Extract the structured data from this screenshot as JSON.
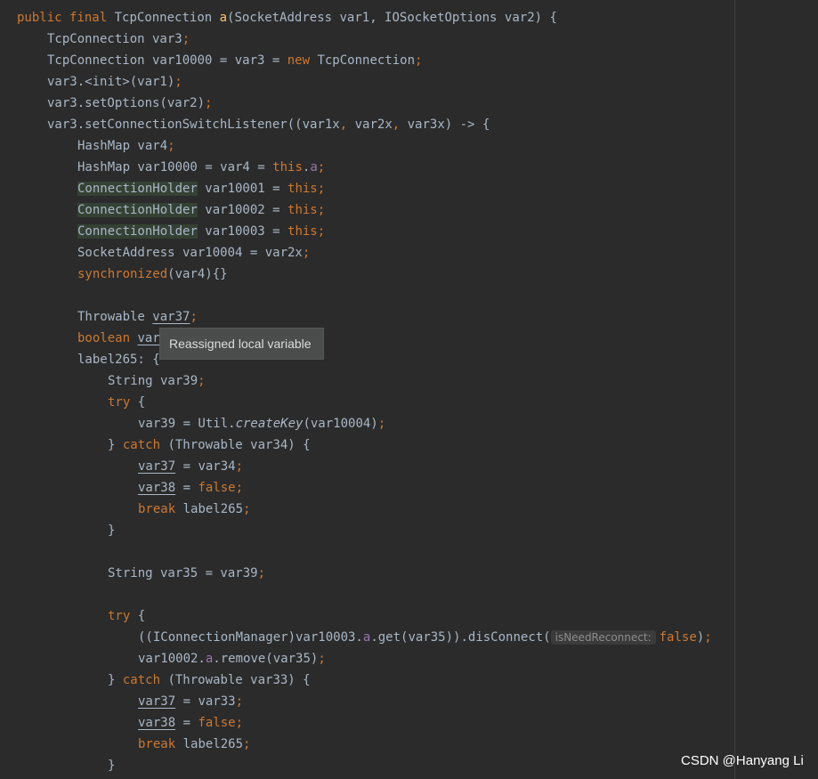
{
  "colors": {
    "background": "#2b2b2b",
    "default_text": "#a9b7c6",
    "keyword": "#cc7832",
    "method_declaration": "#ffc66d",
    "field": "#9876aa",
    "semicolon": "#cc7832",
    "highlight": "#344134",
    "tooltip_background": "#4b4d4d",
    "hint_text": "#8c8c8c"
  },
  "tooltip": {
    "text": "Reassigned local variable"
  },
  "watermark": {
    "text": "CSDN @Hanyang Li"
  },
  "code": {
    "lines": [
      {
        "indent": 0,
        "tokens": [
          {
            "t": "public",
            "c": "kw"
          },
          {
            "t": " ",
            "c": "p"
          },
          {
            "t": "final",
            "c": "kw"
          },
          {
            "t": " TcpConnection ",
            "c": "p"
          },
          {
            "t": "a",
            "c": "fn"
          },
          {
            "t": "(SocketAddress var1, IOSocketOptions var2) {",
            "c": "p"
          }
        ]
      },
      {
        "indent": 1,
        "tokens": [
          {
            "t": "TcpConnection var3",
            "c": "p"
          },
          {
            "t": ";",
            "c": "sc"
          }
        ]
      },
      {
        "indent": 1,
        "tokens": [
          {
            "t": "TcpConnection var10000 = var3 = ",
            "c": "p"
          },
          {
            "t": "new",
            "c": "kw"
          },
          {
            "t": " TcpConnection",
            "c": "p"
          },
          {
            "t": ";",
            "c": "sc"
          }
        ]
      },
      {
        "indent": 1,
        "tokens": [
          {
            "t": "var3.<init>(var1)",
            "c": "p"
          },
          {
            "t": ";",
            "c": "sc"
          }
        ]
      },
      {
        "indent": 1,
        "tokens": [
          {
            "t": "var3.setOptions(var2)",
            "c": "p"
          },
          {
            "t": ";",
            "c": "sc"
          }
        ]
      },
      {
        "indent": 1,
        "tokens": [
          {
            "t": "var3.setConnectionSwitchListener((var1x",
            "c": "p"
          },
          {
            "t": ",",
            "c": "sc"
          },
          {
            "t": " var2x",
            "c": "p"
          },
          {
            "t": ",",
            "c": "sc"
          },
          {
            "t": " var3x) -> {",
            "c": "p"
          }
        ]
      },
      {
        "indent": 2,
        "tokens": [
          {
            "t": "HashMap var4",
            "c": "p"
          },
          {
            "t": ";",
            "c": "sc"
          }
        ]
      },
      {
        "indent": 2,
        "tokens": [
          {
            "t": "HashMap var10000 = var4 = ",
            "c": "p"
          },
          {
            "t": "this",
            "c": "kw"
          },
          {
            "t": ".",
            "c": "p"
          },
          {
            "t": "a",
            "c": "fld"
          },
          {
            "t": ";",
            "c": "sc"
          }
        ]
      },
      {
        "indent": 2,
        "tokens": [
          {
            "t": "ConnectionHolder",
            "c": "p",
            "hl": true
          },
          {
            "t": " var10001 = ",
            "c": "p"
          },
          {
            "t": "this",
            "c": "kw"
          },
          {
            "t": ";",
            "c": "sc"
          }
        ]
      },
      {
        "indent": 2,
        "tokens": [
          {
            "t": "ConnectionHolder",
            "c": "p",
            "hl": true
          },
          {
            "t": " var10002 = ",
            "c": "p"
          },
          {
            "t": "this",
            "c": "kw"
          },
          {
            "t": ";",
            "c": "sc"
          }
        ]
      },
      {
        "indent": 2,
        "tokens": [
          {
            "t": "ConnectionHolder",
            "c": "p",
            "hl": true
          },
          {
            "t": " var10003 = ",
            "c": "p"
          },
          {
            "t": "this",
            "c": "kw"
          },
          {
            "t": ";",
            "c": "sc"
          }
        ]
      },
      {
        "indent": 2,
        "tokens": [
          {
            "t": "SocketAddress var10004 = var2x",
            "c": "p"
          },
          {
            "t": ";",
            "c": "sc"
          }
        ]
      },
      {
        "indent": 2,
        "tokens": [
          {
            "t": "synchronized",
            "c": "kw"
          },
          {
            "t": "(var4){}",
            "c": "p"
          }
        ]
      },
      {
        "indent": 0,
        "tokens": []
      },
      {
        "indent": 2,
        "tokens": [
          {
            "t": "Throwable ",
            "c": "p"
          },
          {
            "t": "var37",
            "c": "p",
            "ul": true
          },
          {
            "t": ";",
            "c": "sc"
          }
        ]
      },
      {
        "indent": 2,
        "tokens": [
          {
            "t": "boolean",
            "c": "kw"
          },
          {
            "t": " ",
            "c": "p"
          },
          {
            "t": "var",
            "c": "p",
            "ul": true
          }
        ]
      },
      {
        "indent": 2,
        "tokens": [
          {
            "t": "label265: {",
            "c": "p"
          }
        ]
      },
      {
        "indent": 3,
        "tokens": [
          {
            "t": "String var39",
            "c": "p"
          },
          {
            "t": ";",
            "c": "sc"
          }
        ]
      },
      {
        "indent": 3,
        "tokens": [
          {
            "t": "try",
            "c": "kw"
          },
          {
            "t": " {",
            "c": "p"
          }
        ]
      },
      {
        "indent": 4,
        "tokens": [
          {
            "t": "var39 = Util.",
            "c": "p"
          },
          {
            "t": "createKey",
            "c": "p",
            "it": true
          },
          {
            "t": "(var10004)",
            "c": "p"
          },
          {
            "t": ";",
            "c": "sc"
          }
        ]
      },
      {
        "indent": 3,
        "tokens": [
          {
            "t": "} ",
            "c": "p"
          },
          {
            "t": "catch",
            "c": "kw"
          },
          {
            "t": " (Throwable var34) {",
            "c": "p"
          }
        ]
      },
      {
        "indent": 4,
        "tokens": [
          {
            "t": "var37",
            "c": "p",
            "ul": true
          },
          {
            "t": " = var34",
            "c": "p"
          },
          {
            "t": ";",
            "c": "sc"
          }
        ]
      },
      {
        "indent": 4,
        "tokens": [
          {
            "t": "var38",
            "c": "p",
            "ul": true
          },
          {
            "t": " = ",
            "c": "p"
          },
          {
            "t": "false",
            "c": "kw"
          },
          {
            "t": ";",
            "c": "sc"
          }
        ]
      },
      {
        "indent": 4,
        "tokens": [
          {
            "t": "break",
            "c": "kw"
          },
          {
            "t": " label265",
            "c": "p"
          },
          {
            "t": ";",
            "c": "sc"
          }
        ]
      },
      {
        "indent": 3,
        "tokens": [
          {
            "t": "}",
            "c": "p"
          }
        ]
      },
      {
        "indent": 0,
        "tokens": []
      },
      {
        "indent": 3,
        "tokens": [
          {
            "t": "String var35 = var39",
            "c": "p"
          },
          {
            "t": ";",
            "c": "sc"
          }
        ]
      },
      {
        "indent": 0,
        "tokens": []
      },
      {
        "indent": 3,
        "tokens": [
          {
            "t": "try",
            "c": "kw"
          },
          {
            "t": " {",
            "c": "p"
          }
        ]
      },
      {
        "indent": 4,
        "tokens": [
          {
            "t": "((IConnectionManager)var10003.",
            "c": "p"
          },
          {
            "t": "a",
            "c": "fld"
          },
          {
            "t": ".get(var35)).disConnect(",
            "c": "p"
          },
          {
            "t": "isNeedReconnect:",
            "c": "hint"
          },
          {
            "t": "false",
            "c": "kw"
          },
          {
            "t": ")",
            "c": "p"
          },
          {
            "t": ";",
            "c": "sc"
          }
        ]
      },
      {
        "indent": 4,
        "tokens": [
          {
            "t": "var10002.",
            "c": "p"
          },
          {
            "t": "a",
            "c": "fld"
          },
          {
            "t": ".remove(var35)",
            "c": "p"
          },
          {
            "t": ";",
            "c": "sc"
          }
        ]
      },
      {
        "indent": 3,
        "tokens": [
          {
            "t": "} ",
            "c": "p"
          },
          {
            "t": "catch",
            "c": "kw"
          },
          {
            "t": " (Throwable var33) {",
            "c": "p"
          }
        ]
      },
      {
        "indent": 4,
        "tokens": [
          {
            "t": "var37",
            "c": "p",
            "ul": true
          },
          {
            "t": " = var33",
            "c": "p"
          },
          {
            "t": ";",
            "c": "sc"
          }
        ]
      },
      {
        "indent": 4,
        "tokens": [
          {
            "t": "var38",
            "c": "p",
            "ul": true
          },
          {
            "t": " = ",
            "c": "p"
          },
          {
            "t": "false",
            "c": "kw"
          },
          {
            "t": ";",
            "c": "sc"
          }
        ]
      },
      {
        "indent": 4,
        "tokens": [
          {
            "t": "break",
            "c": "kw"
          },
          {
            "t": " label265",
            "c": "p"
          },
          {
            "t": ";",
            "c": "sc"
          }
        ]
      },
      {
        "indent": 3,
        "tokens": [
          {
            "t": "}",
            "c": "p"
          }
        ]
      }
    ]
  }
}
